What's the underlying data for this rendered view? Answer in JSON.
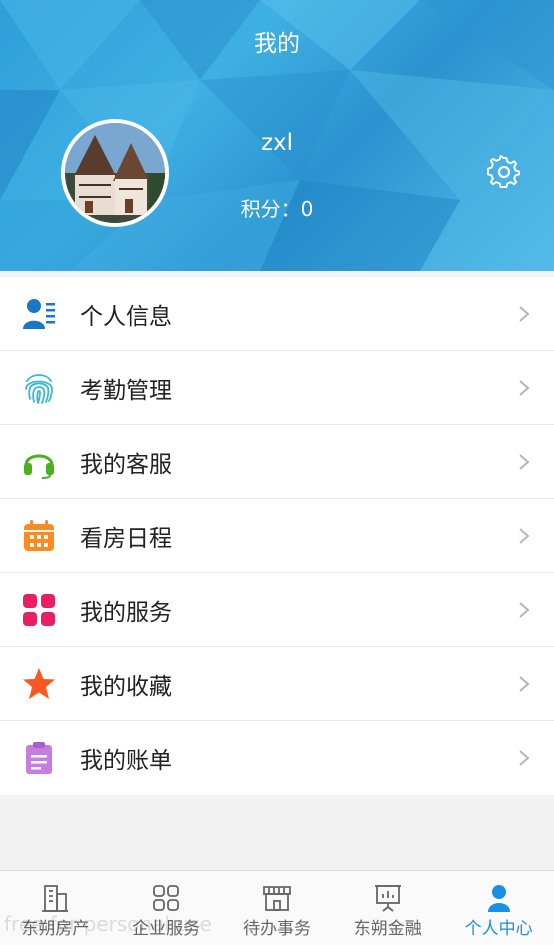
{
  "header": {
    "title": "我的",
    "username": "zxl",
    "points": "积分：0"
  },
  "menu": {
    "items": [
      {
        "label": "个人信息",
        "icon": "user-card-icon",
        "color": "#1a78c2"
      },
      {
        "label": "考勤管理",
        "icon": "fingerprint-icon",
        "color": "#39b7d4"
      },
      {
        "label": "我的客服",
        "icon": "headset-icon",
        "color": "#4caf1e"
      },
      {
        "label": "看房日程",
        "icon": "calendar-icon",
        "color": "#ff8a1f"
      },
      {
        "label": "我的服务",
        "icon": "grid-icon",
        "color": "#e91e63"
      },
      {
        "label": "我的收藏",
        "icon": "star-icon",
        "color": "#ff5722"
      },
      {
        "label": "我的账单",
        "icon": "clipboard-icon",
        "color": "#c77ddf"
      }
    ]
  },
  "tabbar": {
    "tabs": [
      {
        "label": "东朔房产",
        "icon": "building-icon",
        "active": false
      },
      {
        "label": "企业服务",
        "icon": "grid-outline-icon",
        "active": false
      },
      {
        "label": "待办事务",
        "icon": "store-icon",
        "active": false
      },
      {
        "label": "东朔金融",
        "icon": "presentation-icon",
        "active": false
      },
      {
        "label": "个人中心",
        "icon": "person-icon",
        "active": true
      }
    ],
    "active_color": "#1a8fe3"
  },
  "watermark": "free for personal use"
}
